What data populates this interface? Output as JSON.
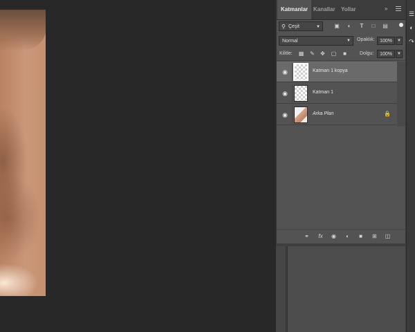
{
  "panel": {
    "tabs": [
      "Katmanlar",
      "Kanallar",
      "Yollar"
    ],
    "filter": {
      "label": "Çeşit",
      "icon": "search-icon"
    },
    "filter_icons": [
      "image-filter-icon",
      "adjustment-filter-icon",
      "type-filter-icon",
      "shape-filter-icon",
      "smart-object-filter-icon"
    ],
    "blend_mode": "Normal",
    "opacity_label": "Opaklık:",
    "opacity_value": "100%",
    "lock_label": "Kilitle:",
    "lock_icons": [
      "lock-transparent-icon",
      "lock-image-icon",
      "lock-position-icon",
      "lock-artboard-icon",
      "lock-all-icon"
    ],
    "fill_label": "Dolgu:",
    "fill_value": "100%",
    "layers": [
      {
        "name": "Katman 1 kopya",
        "selected": true,
        "visible": true,
        "thumb": "transparent"
      },
      {
        "name": "Katman 1",
        "selected": false,
        "visible": true,
        "thumb": "transparent"
      },
      {
        "name": "Arka Plan",
        "selected": false,
        "visible": true,
        "thumb": "photo",
        "locked": true,
        "italic": true
      }
    ],
    "bottom_icons": [
      "link-icon",
      "fx-icon",
      "mask-icon",
      "adjustment-layer-icon",
      "group-folder-icon",
      "new-layer-icon",
      "trash-icon"
    ]
  },
  "colors": {
    "panel_bg": "#535353",
    "selected_layer": "#6a6a6a",
    "workspace_bg": "#282828"
  }
}
